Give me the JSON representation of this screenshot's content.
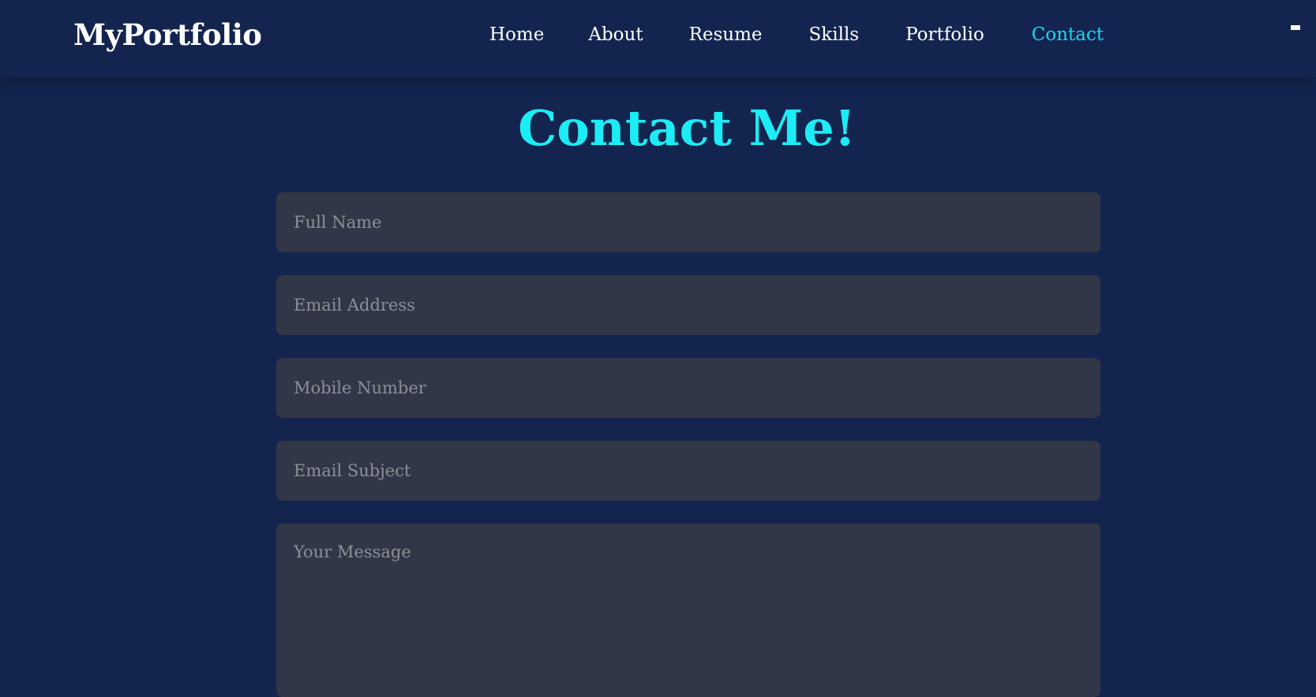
{
  "header": {
    "logo": "MyPortfolio",
    "nav": [
      {
        "label": "Home",
        "active": false
      },
      {
        "label": "About",
        "active": false
      },
      {
        "label": "Resume",
        "active": false
      },
      {
        "label": "Skills",
        "active": false
      },
      {
        "label": "Portfolio",
        "active": false
      },
      {
        "label": "Contact",
        "active": true
      }
    ],
    "menu_icon": "hamburger-menu-icon"
  },
  "contact": {
    "title": "Contact Me!",
    "fields": {
      "full_name": {
        "placeholder": "Full Name",
        "value": ""
      },
      "email": {
        "placeholder": "Email Address",
        "value": ""
      },
      "mobile": {
        "placeholder": "Mobile Number",
        "value": ""
      },
      "subject": {
        "placeholder": "Email Subject",
        "value": ""
      },
      "message": {
        "placeholder": "Your Message",
        "value": ""
      }
    }
  },
  "colors": {
    "background": "#13254f",
    "accent": "#1ad7f0",
    "title": "#1cecf5",
    "field_background": "#313746",
    "placeholder": "#8c8f96"
  }
}
